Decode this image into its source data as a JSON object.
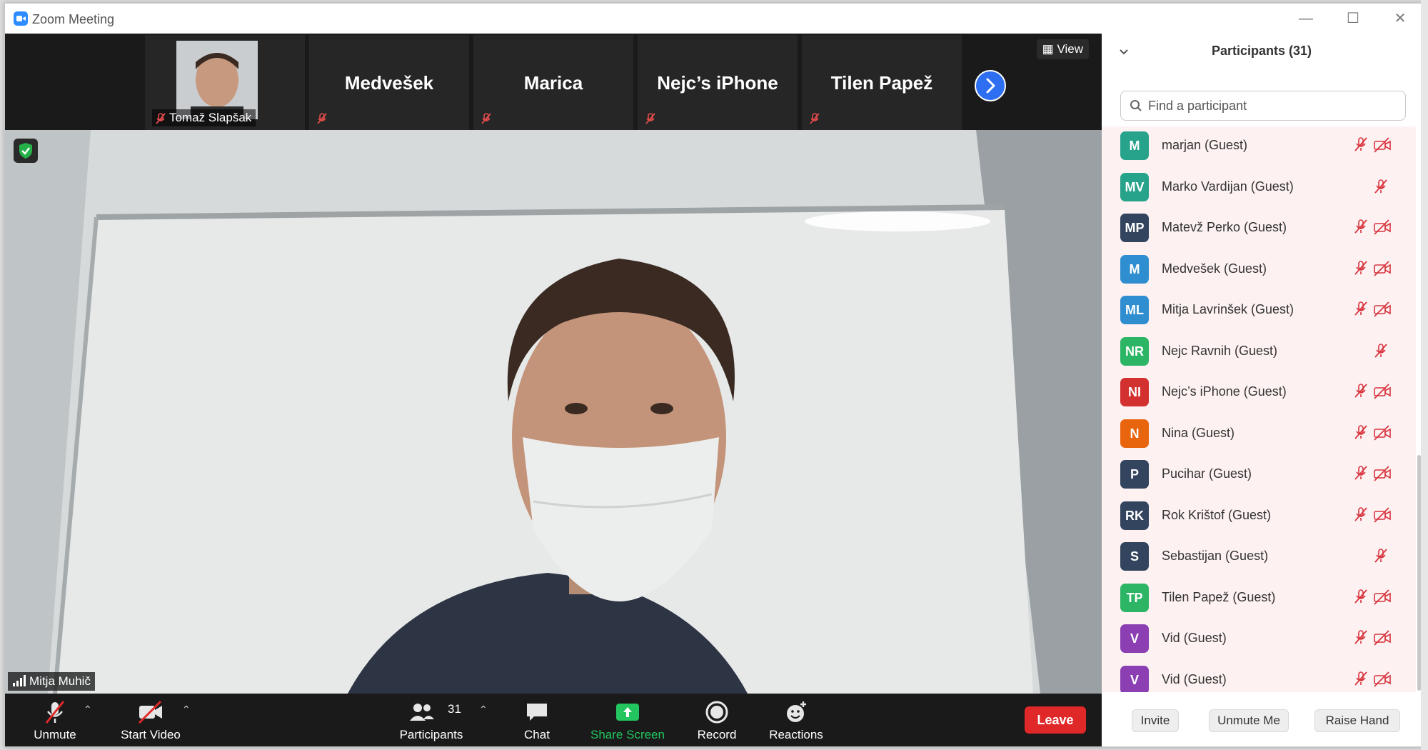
{
  "window": {
    "title": "Zoom Meeting"
  },
  "strip": {
    "tiles": [
      {
        "name": "Tomaž Slapšak",
        "has_video": true
      },
      {
        "name": "Medvešek"
      },
      {
        "name": "Marica"
      },
      {
        "name": "Nejc’s iPhone"
      },
      {
        "name": "Tilen Papež"
      }
    ],
    "view_label": "View"
  },
  "speaker": {
    "name": "Mitja Muhič"
  },
  "toolbar": {
    "unmute": "Unmute",
    "start_video": "Start Video",
    "participants": "Participants",
    "participants_count": "31",
    "chat": "Chat",
    "share_screen": "Share Screen",
    "record": "Record",
    "reactions": "Reactions",
    "leave": "Leave"
  },
  "panel": {
    "title": "Participants (31)",
    "search_placeholder": "Find a participant",
    "participants": [
      {
        "initials": "M",
        "name": "marjan (Guest)",
        "color": "#27a38b",
        "video_off_icon": true
      },
      {
        "initials": "MV",
        "name": "Marko Vardijan (Guest)",
        "color": "#27a38b",
        "video_off_icon": false
      },
      {
        "initials": "MP",
        "name": "Matevž Perko (Guest)",
        "color": "#33455e",
        "video_off_icon": true
      },
      {
        "initials": "M",
        "name": "Medvešek (Guest)",
        "color": "#2f8ed0",
        "video_off_icon": true
      },
      {
        "initials": "ML",
        "name": "Mitja Lavrinšek (Guest)",
        "color": "#2f8ed0",
        "video_off_icon": true
      },
      {
        "initials": "NR",
        "name": "Nejc Ravnih (Guest)",
        "color": "#2db566",
        "video_off_icon": false
      },
      {
        "initials": "NI",
        "name": "Nejc’s iPhone (Guest)",
        "color": "#d2312f",
        "video_off_icon": true
      },
      {
        "initials": "N",
        "name": "Nina (Guest)",
        "color": "#e8650e",
        "video_off_icon": true
      },
      {
        "initials": "P",
        "name": "Pucihar (Guest)",
        "color": "#33455e",
        "video_off_icon": true
      },
      {
        "initials": "RK",
        "name": "Rok Krištof (Guest)",
        "color": "#33455e",
        "video_off_icon": true
      },
      {
        "initials": "S",
        "name": "Sebastijan (Guest)",
        "color": "#33455e",
        "video_off_icon": false
      },
      {
        "initials": "TP",
        "name": "Tilen Papež (Guest)",
        "color": "#2db566",
        "video_off_icon": true
      },
      {
        "initials": "V",
        "name": "Vid (Guest)",
        "color": "#8b3fb3",
        "video_off_icon": true
      },
      {
        "initials": "V",
        "name": "Vid (Guest)",
        "color": "#8b3fb3",
        "video_off_icon": true
      }
    ],
    "buttons": {
      "invite": "Invite",
      "unmute_me": "Unmute Me",
      "raise_hand": "Raise Hand"
    }
  },
  "colors": {
    "leave": "#e02828",
    "share_screen": "#22c55e",
    "muted_icon": "#d8353f",
    "accent": "#2d6ff0"
  }
}
